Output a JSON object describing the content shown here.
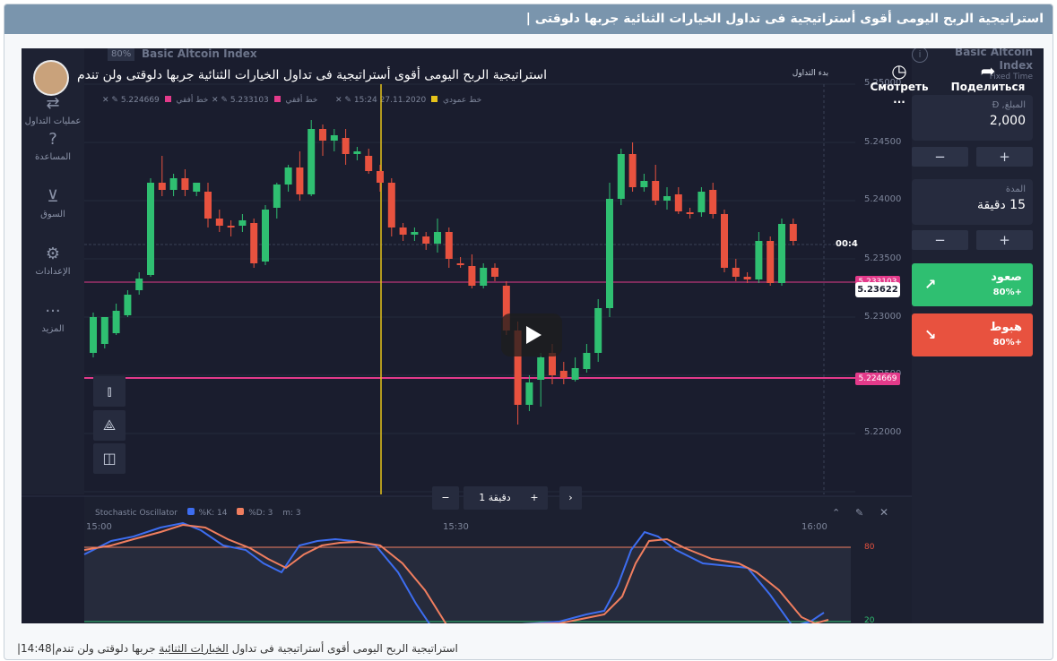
{
  "page": {
    "header_title": "استراتيجية الربح اليومى أقوى أستراتيجية فى تداول الخيارات الثنائية جربها دلوقتى |",
    "footer_prefix": "استراتيجية الربح اليومى أقوى أستراتيجية فى تداول ",
    "footer_link": "الخيارات الثنائية",
    "footer_suffix": " جربها دلوقتى ولن تندم|14:48|"
  },
  "video": {
    "title": "استراتيجية الربح اليومى أقوى أستراتيجية فى تداول الخيارات الثنائية جربها دلوقتى ولن تندم",
    "watch_later": "Смотреть ...",
    "share": "Поделиться"
  },
  "sidebar": {
    "items": [
      {
        "label": "عمليات التداول",
        "icon": "trades-icon"
      },
      {
        "label": "المساعدة",
        "icon": "help-icon"
      },
      {
        "label": "السوق",
        "icon": "cart-icon"
      },
      {
        "label": "الإعدادات",
        "icon": "settings-icon"
      },
      {
        "label": "المزيد",
        "icon": "more-icon"
      }
    ]
  },
  "asset": {
    "badge": "80%",
    "name": "Basic Altcoin Index",
    "right_name": "Basic Altcoin Index",
    "right_sub": "Fixed Time",
    "start_trading": "بدء التداول"
  },
  "chart_tools": {
    "line1": "5.224669",
    "line1_label": "خط أفقي",
    "line2": "5.233103",
    "line2_label": "خط أفقي",
    "vline_time": "27.11.2020 15:24",
    "vline_label": "خط عمودي"
  },
  "trade_panel": {
    "amount_label": "المبلغ, Đ",
    "amount_value": "2,000",
    "duration_label": "المدة",
    "duration_value": "15 دقيقة",
    "minus": "−",
    "plus": "+",
    "up_label": "صعود",
    "up_pct": "+80%",
    "down_label": "هبوط",
    "down_pct": "+80%"
  },
  "timeframe": {
    "value": "1 دقيقة",
    "minus": "−",
    "plus": "+",
    "next": "›"
  },
  "price_axis": {
    "labels": [
      "5.25000",
      "5.24500",
      "5.24000",
      "5.23500",
      "5.23000",
      "5.22500",
      "5.22000"
    ],
    "current": "5.23622",
    "current_timer": "00:4"
  },
  "time_axis": {
    "labels": [
      "15:00",
      "15:30",
      "16:00"
    ]
  },
  "stochastic": {
    "title": "Stochastic Oscillator",
    "k": "%K: 14",
    "d": "%D: 3",
    "m": "m: 3",
    "upper": "80",
    "lower": "20"
  },
  "colors": {
    "up": "#2fbf71",
    "down": "#e8523f",
    "hline": "#e33a8a",
    "vline": "#e6c31a",
    "k_line": "#3d6df0",
    "d_line": "#f07e5f"
  }
}
